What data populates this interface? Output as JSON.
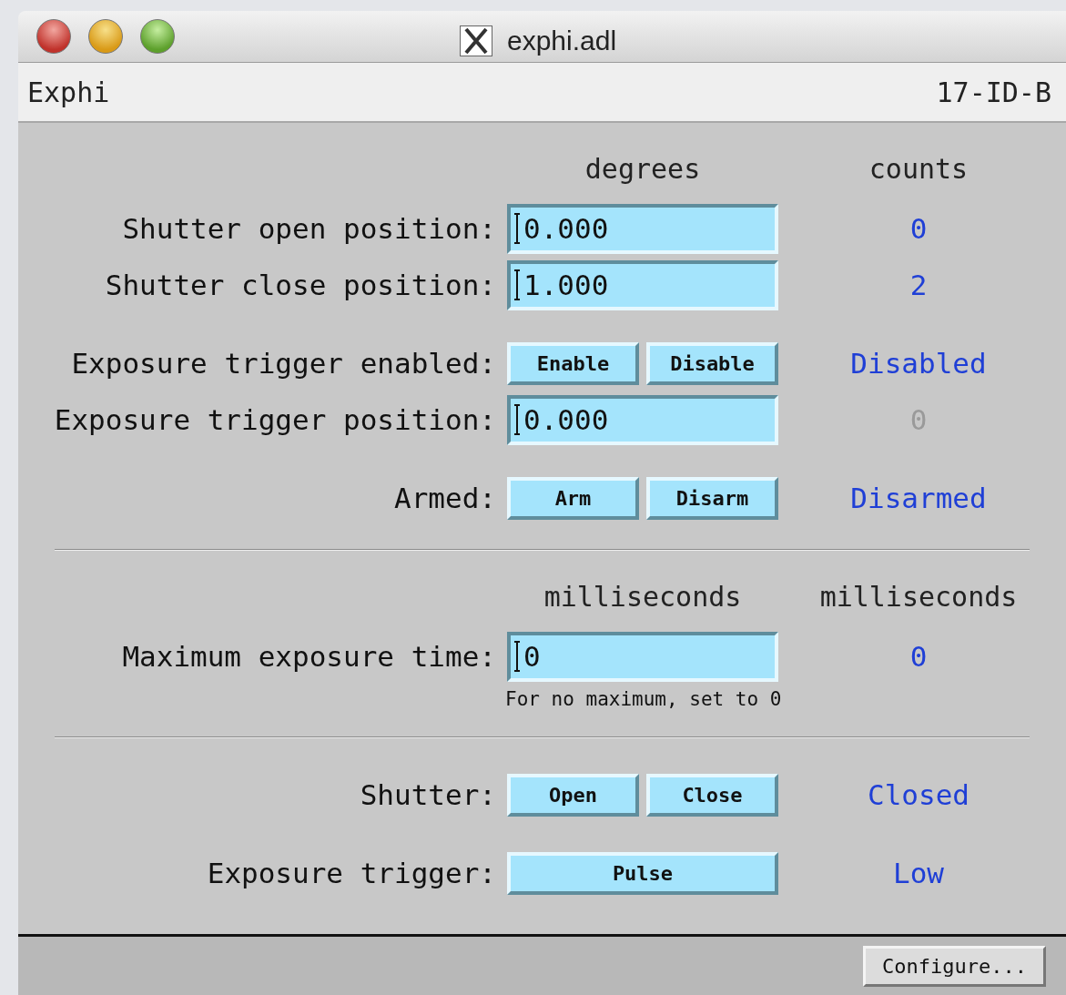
{
  "window": {
    "title": "exphi.adl",
    "buttons": [
      {
        "kind": "close"
      },
      {
        "kind": "minimize"
      },
      {
        "kind": "zoom"
      }
    ]
  },
  "header": {
    "name": "Exphi",
    "prefix": "17-ID-B"
  },
  "panels": [
    {
      "columns": [
        "degrees",
        "counts"
      ],
      "groups": [
        [
          {
            "kind": "field",
            "label": "Shutter open position:",
            "value": "0.000",
            "readback": {
              "text": "0",
              "color": "#1f3fd6"
            }
          },
          {
            "kind": "field",
            "label": "Shutter close position:",
            "value": "1.000",
            "readback": {
              "text": "2",
              "color": "#1f3fd6"
            }
          }
        ],
        [
          {
            "kind": "buttons",
            "label": "Exposure trigger enabled:",
            "buttons": [
              "Enable",
              "Disable"
            ],
            "readback": {
              "text": "Disabled",
              "color": "#1f3fd6"
            }
          },
          {
            "kind": "field",
            "label": "Exposure trigger position:",
            "value": "0.000",
            "readback": {
              "text": "0",
              "color": "#9a9a9a"
            }
          }
        ],
        [
          {
            "kind": "buttons",
            "label": "Armed:",
            "buttons": [
              "Arm",
              "Disarm"
            ],
            "readback": {
              "text": "Disarmed",
              "color": "#1f3fd6"
            }
          }
        ]
      ]
    },
    {
      "columns": [
        "milliseconds",
        "milliseconds"
      ],
      "groups": [
        [
          {
            "kind": "field",
            "label": "Maximum exposure time:",
            "value": "0",
            "readback": {
              "text": "0",
              "color": "#1f3fd6"
            }
          },
          {
            "kind": "note",
            "text": "For no maximum, set to 0"
          }
        ]
      ]
    },
    {
      "groups": [
        [
          {
            "kind": "buttons",
            "label": "Shutter:",
            "buttons": [
              "Open",
              "Close"
            ],
            "readback": {
              "text": "Closed",
              "color": "#1f3fd6"
            }
          }
        ],
        [
          {
            "kind": "buttons",
            "label": "Exposure trigger:",
            "buttons": [
              "Pulse"
            ],
            "readback": {
              "text": "Low",
              "color": "#1f3fd6"
            }
          }
        ]
      ]
    }
  ],
  "footer": {
    "buttons": [
      "Configure..."
    ]
  }
}
